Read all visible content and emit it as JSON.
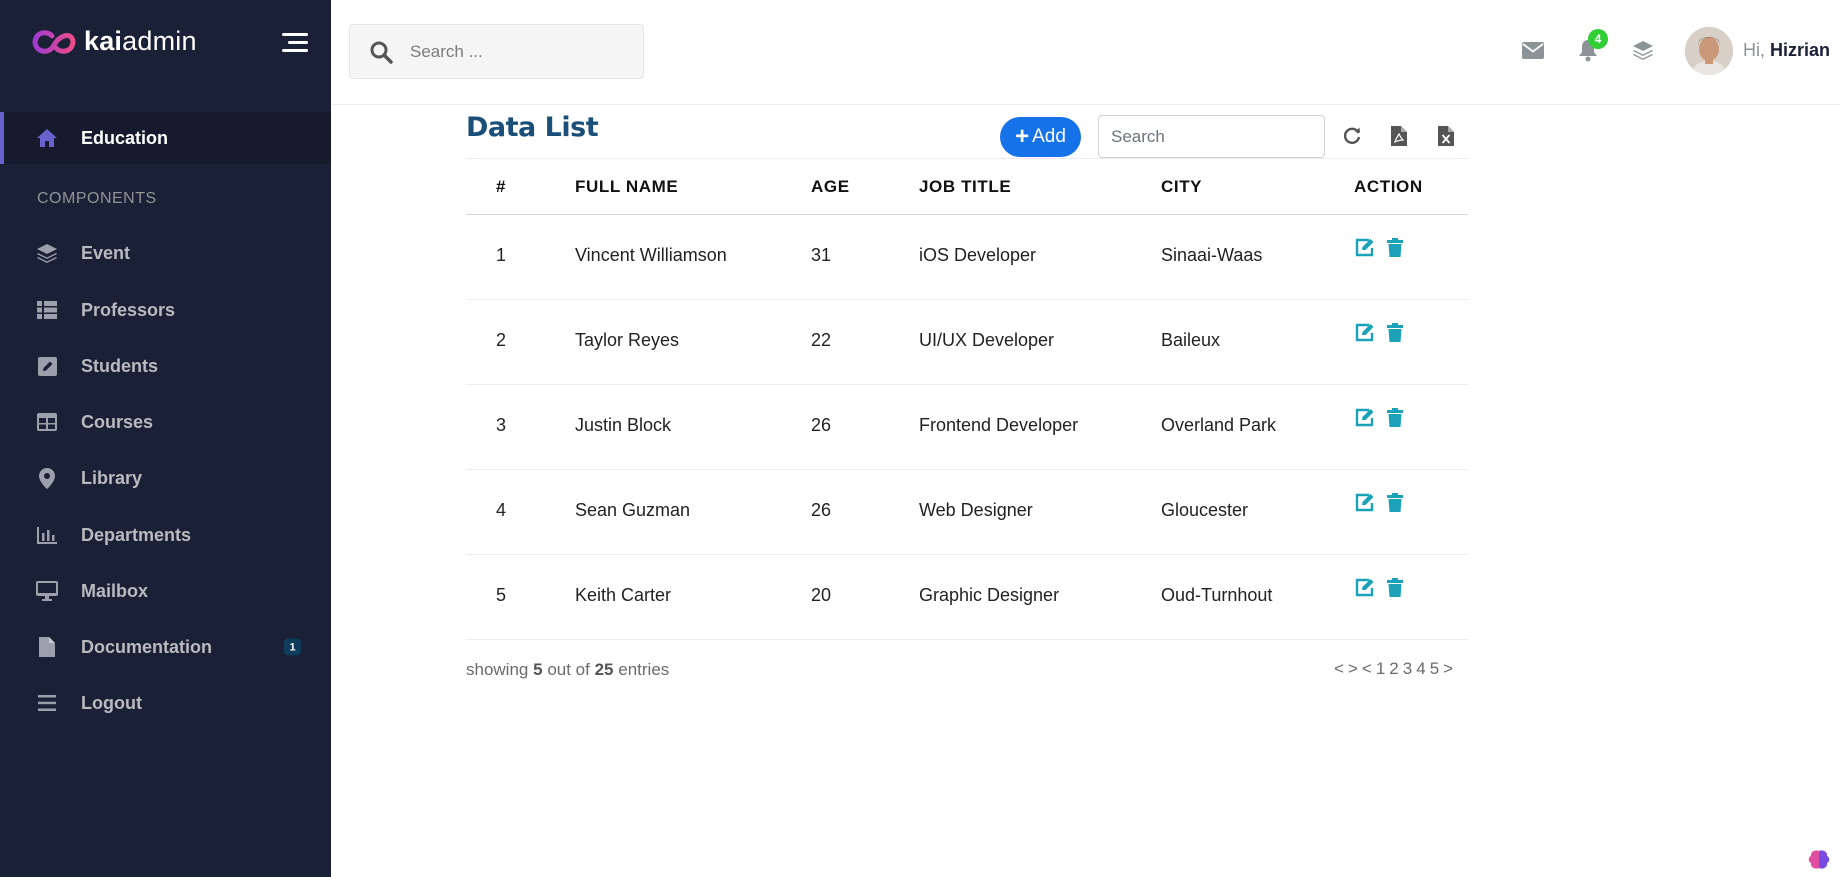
{
  "brand": {
    "name_bold": "kai",
    "name_rest": "admin"
  },
  "sidebar": {
    "active_item": {
      "label": "Education",
      "icon": "home-icon"
    },
    "section_title": "COMPONENTS",
    "items": [
      {
        "label": "Event",
        "icon": "layers-icon"
      },
      {
        "label": "Professors",
        "icon": "th-list-icon"
      },
      {
        "label": "Students",
        "icon": "pen-square-icon"
      },
      {
        "label": "Courses",
        "icon": "table-icon"
      },
      {
        "label": "Library",
        "icon": "map-marker-icon"
      },
      {
        "label": "Departments",
        "icon": "bar-chart-icon"
      },
      {
        "label": "Mailbox",
        "icon": "desktop-icon"
      },
      {
        "label": "Documentation",
        "icon": "file-icon",
        "badge": "1"
      },
      {
        "label": "Logout",
        "icon": "bars-icon"
      }
    ]
  },
  "header": {
    "search_placeholder": "Search ...",
    "notification_count": "4",
    "greeting_prefix": "Hi,",
    "user_name": "Hizrian"
  },
  "content": {
    "title": "Data List",
    "add_label": "Add",
    "search_placeholder": "Search",
    "columns": [
      "#",
      "FULL NAME",
      "AGE",
      "JOB TITLE",
      "CITY",
      "ACTION"
    ],
    "rows": [
      {
        "id": "1",
        "name": "Vincent Williamson",
        "age": "31",
        "job": "iOS Developer",
        "city": "Sinaai-Waas"
      },
      {
        "id": "2",
        "name": "Taylor Reyes",
        "age": "22",
        "job": "UI/UX Developer",
        "city": "Baileux"
      },
      {
        "id": "3",
        "name": "Justin Block",
        "age": "26",
        "job": "Frontend Developer",
        "city": "Overland Park"
      },
      {
        "id": "4",
        "name": "Sean Guzman",
        "age": "26",
        "job": "Web Designer",
        "city": "Gloucester"
      },
      {
        "id": "5",
        "name": "Keith Carter",
        "age": "20",
        "job": "Graphic Designer",
        "city": "Oud-Turnhout"
      }
    ],
    "footer": {
      "prefix": "showing",
      "shown": "5",
      "middle": "out of",
      "total": "25",
      "suffix": "entries"
    },
    "pagination": [
      "<",
      ">",
      "<",
      "1",
      "2",
      "3",
      "4",
      "5",
      ">"
    ]
  },
  "colors": {
    "sidebar_bg": "#1a2035",
    "accent_purple": "#6861ce",
    "primary_blue": "#1572e8",
    "action_teal": "#1ba2b9",
    "badge_green": "#31ce36"
  }
}
